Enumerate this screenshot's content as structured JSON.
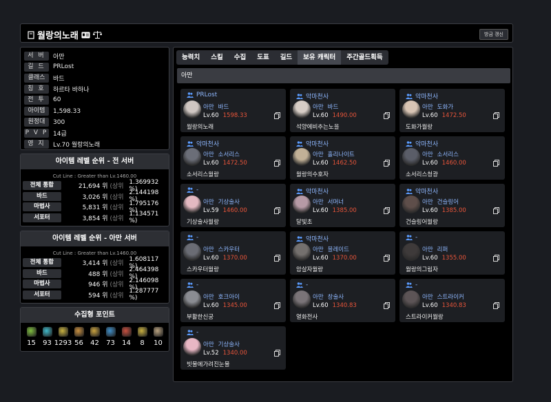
{
  "header": {
    "title": "월랑의노래",
    "update_label": "방금 갱신"
  },
  "info": [
    {
      "label": "서 버",
      "value": "아만",
      "tight": false
    },
    {
      "label": "길 드",
      "value": "PRLost",
      "tight": false
    },
    {
      "label": "클래스",
      "value": "바드",
      "tight": true
    },
    {
      "label": "칭 호",
      "value": "하르타 바하나",
      "tight": false
    },
    {
      "label": "전 투",
      "value": "60",
      "tight": false
    },
    {
      "label": "아이템",
      "value": "1,598.33",
      "tight": true
    },
    {
      "label": "원정대",
      "value": "300",
      "tight": true
    },
    {
      "label": "P V P",
      "value": "14급",
      "tight": false
    },
    {
      "label": "영 지",
      "value": "Lv.70 월랑의노래",
      "tight": false
    }
  ],
  "rank_all": {
    "title": "아이템 레벨 순위 - 전 서버",
    "cut": "Cut Line : Greater than Lv.1460.00",
    "rows": [
      {
        "label": "전체 통합",
        "rank": "21,694 위",
        "sub": "(상위",
        "pct": "1.369932 %)"
      },
      {
        "label": "바드",
        "rank": "3,026 위",
        "sub": "(상위",
        "pct": "2.144198 %)"
      },
      {
        "label": "마법사",
        "rank": "5,831 위",
        "sub": "(상위",
        "pct": "1.795176 %)"
      },
      {
        "label": "서포터",
        "rank": "3,854 위",
        "sub": "(상위",
        "pct": "1.134571 %)"
      }
    ]
  },
  "rank_server": {
    "title": "아이템 레벨 순위 - 아만 서버",
    "cut": "Cut Line : Greater than Lv.1460.00",
    "rows": [
      {
        "label": "전체 통합",
        "rank": "3,414 위",
        "sub": "(상위",
        "pct": "1.608117 %)"
      },
      {
        "label": "바드",
        "rank": "488 위",
        "sub": "(상위",
        "pct": "2.464398 %)"
      },
      {
        "label": "마법사",
        "rank": "946 위",
        "sub": "(상위",
        "pct": "2.146098 %)"
      },
      {
        "label": "서포터",
        "rank": "594 위",
        "sub": "(상위",
        "pct": "1.287777 %)"
      }
    ]
  },
  "collect": {
    "title": "수집형 포인트",
    "items": [
      {
        "icon": "mokoko-seed-icon",
        "value": "15",
        "color": "#7fbf3f"
      },
      {
        "icon": "island-heart-icon",
        "value": "93",
        "color": "#3fb9c9"
      },
      {
        "icon": "giant-heart-icon",
        "value": "1293",
        "color": "#c9b23f"
      },
      {
        "icon": "art-icon",
        "value": "56",
        "color": "#c98f3f"
      },
      {
        "icon": "voyage-icon",
        "value": "42",
        "color": "#c9a23f"
      },
      {
        "icon": "world-tree-leaf-icon",
        "value": "73",
        "color": "#3f8fc9"
      },
      {
        "icon": "ignea-token-icon",
        "value": "14",
        "color": "#c94f3f"
      },
      {
        "icon": "orpheus-star-icon",
        "value": "8",
        "color": "#c9b03f"
      },
      {
        "icon": "mokoko-icon",
        "value": "10",
        "color": "#b9a27f"
      }
    ]
  },
  "tabs": [
    "능력치",
    "스킬",
    "수집",
    "도표",
    "길드",
    "보유 캐릭터",
    "주간골드획득"
  ],
  "active_tab": 5,
  "server_header": "아만",
  "characters": [
    {
      "guild": "PRLost",
      "server": "아만",
      "class": "바드",
      "level": "Lv.60",
      "ilvl": "1598.33",
      "name": "월랑의노래",
      "avatar": "#cfc6c2"
    },
    {
      "guild": "악마천사",
      "server": "아만",
      "class": "바드",
      "level": "Lv.60",
      "ilvl": "1490.00",
      "name": "석양에비추는노을",
      "avatar": "#d7cdc6"
    },
    {
      "guild": "악마천사",
      "server": "아만",
      "class": "도화가",
      "level": "Lv.60",
      "ilvl": "1472.50",
      "name": "도화가월랑",
      "avatar": "#d8c4b4"
    },
    {
      "guild": "악마천사",
      "server": "아만",
      "class": "소서리스",
      "level": "Lv.60",
      "ilvl": "1472.50",
      "name": "소서리스월랑",
      "avatar": "#6b6e78"
    },
    {
      "guild": "악마천사",
      "server": "아만",
      "class": "홀리나이트",
      "level": "Lv.60",
      "ilvl": "1462.50",
      "name": "월랑의수호자",
      "avatar": "#c2b197"
    },
    {
      "guild": "악마천사",
      "server": "아만",
      "class": "소서리스",
      "level": "Lv.60",
      "ilvl": "1460.00",
      "name": "소서리스청광",
      "avatar": "#5a5d68"
    },
    {
      "guild": "-",
      "server": "아만",
      "class": "기상술사",
      "level": "Lv.59",
      "ilvl": "1460.00",
      "name": "기상술사월랑",
      "avatar": "#e3b9c1"
    },
    {
      "guild": "악마천사",
      "server": "아만",
      "class": "서머너",
      "level": "Lv.60",
      "ilvl": "1385.00",
      "name": "달빛초",
      "avatar": "#b69aa6"
    },
    {
      "guild": "악마천사",
      "server": "아만",
      "class": "건슬링어",
      "level": "Lv.60",
      "ilvl": "1385.00",
      "name": "건슬링어월랑",
      "avatar": "#5e4e4a"
    },
    {
      "guild": "-",
      "server": "아만",
      "class": "스카우터",
      "level": "Lv.60",
      "ilvl": "1370.00",
      "name": "스카우터월랑",
      "avatar": "#6a6c74"
    },
    {
      "guild": "악마천사",
      "server": "아만",
      "class": "블레이드",
      "level": "Lv.60",
      "ilvl": "1370.00",
      "name": "암살자월랑",
      "avatar": "#74706e"
    },
    {
      "guild": "-",
      "server": "아만",
      "class": "리퍼",
      "level": "Lv.60",
      "ilvl": "1355.00",
      "name": "월랑의그림자",
      "avatar": "#3e3a3a"
    },
    {
      "guild": "-",
      "server": "아만",
      "class": "호크아이",
      "level": "Lv.60",
      "ilvl": "1345.00",
      "name": "부활한신궁",
      "avatar": "#8a8c92"
    },
    {
      "guild": "-",
      "server": "아만",
      "class": "창술사",
      "level": "Lv.60",
      "ilvl": "1340.83",
      "name": "열화전사",
      "avatar": "#7a7478"
    },
    {
      "guild": "-",
      "server": "아만",
      "class": "스트라이커",
      "level": "Lv.60",
      "ilvl": "1340.83",
      "name": "스트라이커월랑",
      "avatar": "#5c5456"
    },
    {
      "guild": "-",
      "server": "아만",
      "class": "기상술사",
      "level": "Lv.52",
      "ilvl": "1340.00",
      "name": "빗물에가려진눈물",
      "avatar": "#e8b7c4"
    }
  ]
}
